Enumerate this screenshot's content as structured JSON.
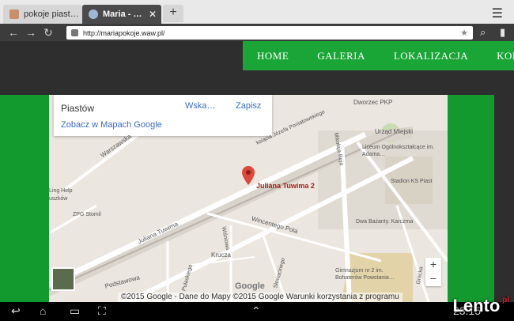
{
  "browser": {
    "tabs": [
      {
        "title": "pokoje piast…"
      },
      {
        "title": "Maria - …"
      }
    ],
    "new_tab": "+",
    "url": "http://mariapokoje.waw.pl/"
  },
  "site_nav": [
    "HOME",
    "GALERIA",
    "LOKALIZACJA",
    "KON"
  ],
  "map": {
    "infobox": {
      "place": "Piastów",
      "directions": "Wska…",
      "save": "Zapisz",
      "link": "Zobacz w Mapach Google"
    },
    "marker_label": "Juliana Tuwima 2",
    "street_labels": [
      "Dworzec PKP",
      "Urząd Miejski",
      "Liceum Ogólnokształcące im. Adama…",
      "Stadion KS Piast",
      "Dwa Bażanty. Karczma",
      "Gimnazjum nr 2 im. Bohaterów Powstania…",
      "ZPG Stomil",
      "Juliana Tuwima",
      "Wincentego Pola",
      "Warszawska",
      "ksiącia Józefa Poniatowskiego",
      "Mikołaja Reja",
      "Krucza",
      "Wiśniowa",
      "Podstawowa",
      "Pułaskiego",
      "Słowackiego",
      "Gracka",
      "Ling Help",
      "uszków"
    ],
    "zoom_in": "+",
    "zoom_out": "−",
    "google_logo": "Google",
    "footer": "©2015 Google - Dane do Mapy ©2015 Google   Warunki korzystania z programu"
  },
  "system": {
    "clock": "23:15"
  },
  "watermark": {
    "text": "Lento",
    "suffix": ".pl"
  }
}
